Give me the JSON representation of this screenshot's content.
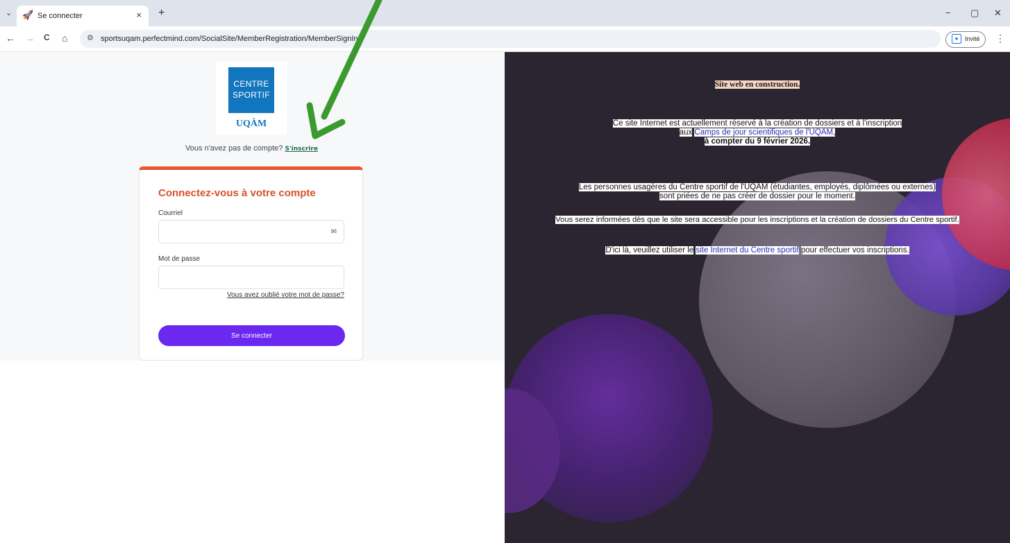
{
  "browser": {
    "tab_title": "Se connecter",
    "tab_close": "×",
    "new_tab": "+",
    "menu_caret": "⌄",
    "url": "sportsuqam.perfectmind.com/SocialSite/MemberRegistration/MemberSignIn",
    "profile_label": "Invité",
    "window_controls": [
      "−",
      "▢",
      "✕"
    ],
    "nav": [
      "←",
      "→",
      "C",
      "⌂"
    ],
    "kebab": "⋮"
  },
  "logo": {
    "line1": "CENTRE",
    "line2": "SPORTIF",
    "brand": "UQÀM"
  },
  "signup": {
    "prompt": "Vous n'avez pas de compte?",
    "link": "S'inscrire"
  },
  "login": {
    "title": "Connectez-vous à votre compte",
    "email_label": "Courriel",
    "email_value": "",
    "password_label": "Mot de passe",
    "password_value": "",
    "forgot": "Vous avez oublié votre mot de passe?",
    "submit": "Se connecter"
  },
  "info": {
    "notice": "Site web en construction.",
    "p1_line1": "Ce site Internet est actuellement réservé à la création de dossiers et à l'inscription",
    "p1_line2_prefix": "aux",
    "p1_link": "Camps de jour scientifiques de l'UQAM",
    "p1_line2_suffix": ",",
    "p1_line3": "à compter du 9 février 2026.",
    "p2_line1": "Les personnes usagères du Centre sportif de l'UQAM (étudiantes, employés, diplômées ou externes)",
    "p2_line2": "sont priées de ne pas créer de dossier pour le moment.",
    "p3": "Vous serez informées dès que le site sera accessible pour les inscriptions et la création de dossiers du Centre sportif.",
    "p4_prefix": "D'ici là, veuillez utiliser le",
    "p4_link": "site Internet du Centre sportif",
    "p4_suffix": "pour effectuer vos inscriptions."
  },
  "colors": {
    "accent_orange": "#e8562b",
    "button_purple": "#6a28f0",
    "uqam_blue": "#1176be",
    "arrow_green": "#3a9a2e",
    "right_bg": "#2a2530"
  }
}
